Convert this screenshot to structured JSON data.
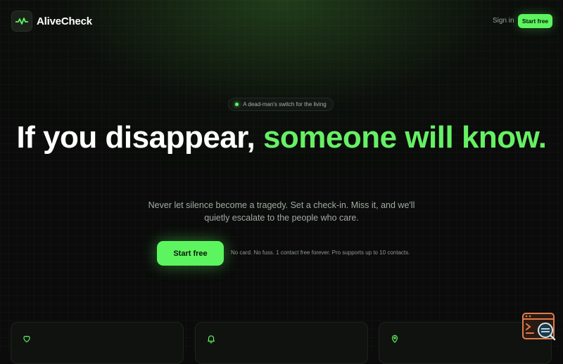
{
  "brand": {
    "name": "AliveCheck",
    "logo_icon": "pulse-icon",
    "accent": "#5cf55f"
  },
  "nav": {
    "sign_in": "Sign in",
    "cta": "Start free"
  },
  "hero": {
    "badge": "A dead-man's switch for the living",
    "headline_white": "If you disappear,",
    "headline_green": "someone will know.",
    "subtitle": "Never let silence become a tragedy. Set a check-in. Miss it, and we'll quietly escalate to the people who care.",
    "cta": "Start free",
    "note": "No card. No fuss. 1 contact free forever. Pro supports up to 10 contacts."
  },
  "features": [
    {
      "icon": "heart-icon"
    },
    {
      "icon": "bell-icon"
    },
    {
      "icon": "map-pin-icon"
    }
  ],
  "colors": {
    "background": "#0a0b0a",
    "headline_green": "#66f064",
    "widget_orange": "#e07b4a"
  }
}
